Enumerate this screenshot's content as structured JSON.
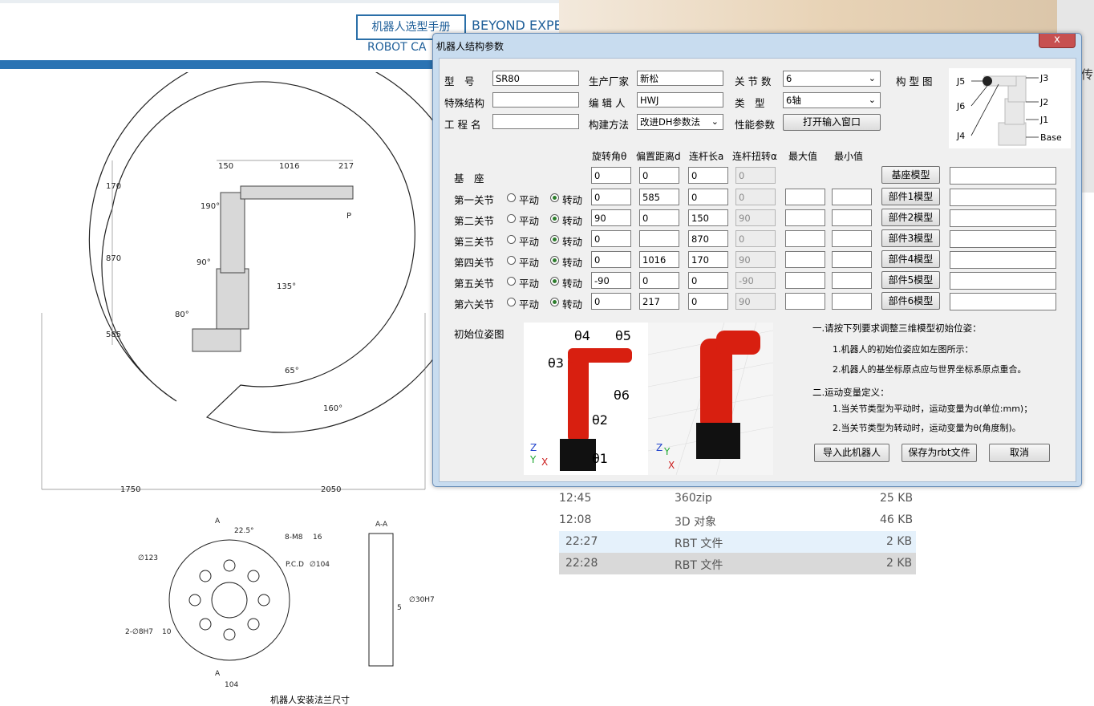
{
  "background_doc": {
    "brand_box": "机器人选型手册",
    "brand_beyond": "BEYOND EXPEC",
    "brand_robot": "ROBOT CA",
    "drawing_dims": [
      "150",
      "1016",
      "217",
      "170",
      "870",
      "585",
      "1750",
      "2050",
      "190°",
      "90°",
      "135°",
      "80°",
      "65°",
      "160°",
      "P"
    ],
    "flange_labels": [
      "A",
      "22.5°",
      "8-M8",
      "16",
      "∅123",
      "P.C.D",
      "∅104",
      "2-∅8H7",
      "10",
      "A",
      "104",
      "A-A",
      "∅30H7",
      "5"
    ],
    "caption": "机器人安装法兰尺寸",
    "edge_char": "传"
  },
  "file_list": [
    {
      "time": "12:45",
      "type": "360zip",
      "size": "25 KB"
    },
    {
      "time": "12:08",
      "type": "3D 对象",
      "size": "46 KB"
    },
    {
      "time": "22:27",
      "type": "RBT 文件",
      "size": "2 KB"
    },
    {
      "time": "22:28",
      "type": "RBT 文件",
      "size": "2 KB"
    }
  ],
  "dialog": {
    "title": "机器人结构参数",
    "close": "x",
    "labels": {
      "model": "型　号",
      "maker": "生产厂家",
      "joints": "关 节 数",
      "diagram": "构 型 图",
      "special": "特殊结构",
      "editor": "编 辑 人",
      "type": "类　型",
      "project": "工 程 名",
      "method": "构建方法",
      "perf": "性能参数"
    },
    "values": {
      "model": "SR80",
      "maker": "新松",
      "joints": "6",
      "special": "",
      "editor": "HWJ",
      "type": "6轴",
      "project": "",
      "method": "改进DH参数法"
    },
    "open_input_button": "打开输入窗口",
    "config_labels": [
      "J5",
      "J3",
      "J6",
      "J2",
      "J1",
      "J4",
      "Base"
    ],
    "table_headers": [
      "旋转角θ",
      "偏置距离d",
      "连杆长a",
      "连杆扭转α",
      "最大值",
      "最小值"
    ],
    "radio_labels": {
      "prismatic": "平动",
      "revolute": "转动"
    },
    "base_row": {
      "label": "基　座",
      "theta": "0",
      "d": "0",
      "a": "0",
      "alpha": "0",
      "button": "基座模型"
    },
    "joints_rows": [
      {
        "label": "第一关节",
        "theta": "0",
        "d": "585",
        "a": "0",
        "alpha": "0",
        "button": "部件1模型"
      },
      {
        "label": "第二关节",
        "theta": "90",
        "d": "0",
        "a": "150",
        "alpha": "90",
        "button": "部件2模型"
      },
      {
        "label": "第三关节",
        "theta": "0",
        "d": "",
        "a": "870",
        "alpha": "0",
        "button": "部件3模型"
      },
      {
        "label": "第四关节",
        "theta": "0",
        "d": "1016",
        "a": "170",
        "alpha": "90",
        "button": "部件4模型"
      },
      {
        "label": "第五关节",
        "theta": "-90",
        "d": "0",
        "a": "0",
        "alpha": "-90",
        "button": "部件5模型"
      },
      {
        "label": "第六关节",
        "theta": "0",
        "d": "217",
        "a": "0",
        "alpha": "90",
        "button": "部件6模型"
      }
    ],
    "init_pose_label": "初始位姿图",
    "pose_labels": [
      "θ4",
      "θ5",
      "θ3",
      "θ6",
      "θ2",
      "θ1",
      "Z",
      "Y",
      "X",
      "Z",
      "Y",
      "X"
    ],
    "notes": [
      "一.请按下列要求调整三维模型初始位姿：",
      "1.机器人的初始位姿应如左图所示：",
      "2.机器人的基坐标原点应与世界坐标系原点重合。",
      "二.运动变量定义：",
      "1.当关节类型为平动时，运动变量为d(单位:mm)；",
      "2.当关节类型为转动时，运动变量为θ(角度制)。"
    ],
    "buttons": {
      "import": "导入此机器人",
      "save": "保存为rbt文件",
      "cancel": "取消"
    }
  }
}
